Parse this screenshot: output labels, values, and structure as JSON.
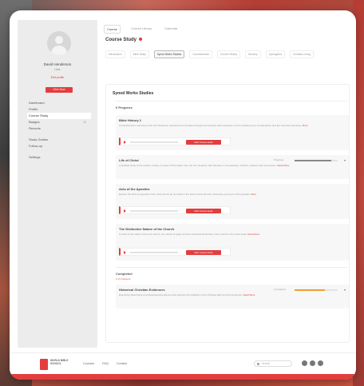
{
  "sidebar": {
    "user_name": "David Henderson",
    "user_role": "User",
    "user_link": "Edit profile",
    "button_label": "Give Now",
    "nav": [
      {
        "label": "Dashboard"
      },
      {
        "label": "Profile"
      },
      {
        "label": "Course Study",
        "active": true
      },
      {
        "label": "Badges",
        "count": "12"
      },
      {
        "label": "Records"
      },
      {
        "label": "Study Guides"
      },
      {
        "label": "Follow-up"
      },
      {
        "label": "Settings"
      }
    ]
  },
  "main": {
    "top_tabs": [
      "Course",
      "Course Library",
      "Calendar"
    ],
    "page_title": "Course Study",
    "subtabs": [
      {
        "label": "Introduction"
      },
      {
        "label": "Bible Study"
      },
      {
        "label": "Synod Works Studies",
        "active": true
      },
      {
        "label": "Commentaries"
      },
      {
        "label": "Church History"
      },
      {
        "label": "Worship"
      },
      {
        "label": "Apologetics"
      },
      {
        "label": "Christian Living"
      }
    ],
    "card_title": "Synod Works Studies",
    "section1_head": "0 Progress",
    "section2_head": "Completed",
    "section2_sub": "1 of 2 lessons",
    "lessons": [
      {
        "title": "Bible History 1",
        "desc": "Comprehensive overview of the Old Testament narrative from Creation through the Prophets with emphasis on the unfolding story of redemption and the covenant promises.",
        "more": "More",
        "audio_btn": "Start Course Audio",
        "audio_time": "00:00 / 00:00",
        "progress": null
      },
      {
        "title": "Life of Christ",
        "desc": "A detailed study of the earthly ministry of Jesus Christ drawn from the four Gospels, with attention to his teaching, miracles, passion and resurrection.",
        "more": "Read More",
        "audio_btn": null,
        "progress": {
          "label": "Progress",
          "value": 0.85,
          "color": "#888888"
        }
      },
      {
        "title": "Acts of the Apostles",
        "desc": "Explore the birth and growth of the early church as recorded in the book of Acts and the missionary journeys of the apostles.",
        "more": "More",
        "audio_btn": "Start Course Audio",
        "audio_time": "00:00 / 00:00",
        "progress": null
      },
      {
        "title": "The Distinctive Nature of the Church",
        "desc": "A study of the marks of the true church, the means of grace and the confessional identity of the church in the world today.",
        "more": "Read More",
        "audio_btn": "Start Course Audio",
        "audio_time": "00:00 / 00:00",
        "progress": null
      },
      {
        "title": "Historical Christian Evidences",
        "desc": "Examining historical and archaeological evidence that supports the reliability of the Christian faith and the Scriptures.",
        "more": "Read More",
        "audio_btn": null,
        "progress": {
          "label": "In progress",
          "value": 0.7,
          "color": "#f0a030"
        }
      }
    ]
  },
  "footer": {
    "logo_text": "WORLD BIBLE SCHOOL",
    "nav": [
      "Courses",
      "FAQ",
      "Contact"
    ],
    "search_placeholder": "Search"
  },
  "colors": {
    "accent": "#e33d3d",
    "progress_orange": "#f0a030"
  }
}
